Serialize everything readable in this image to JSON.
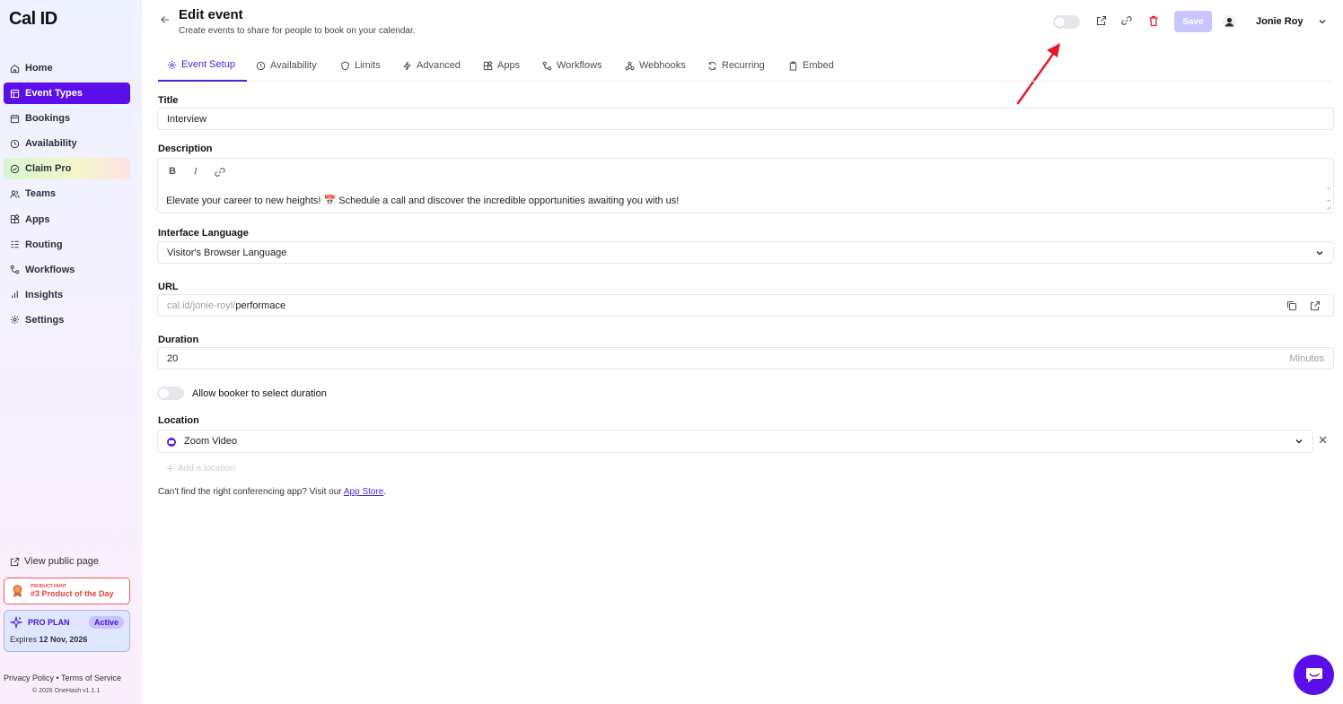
{
  "brand": {
    "logo_text": "Cal ID",
    "accent": "#5b0fe8"
  },
  "sidebar": {
    "items": [
      {
        "label": "Home",
        "icon": "home-icon"
      },
      {
        "label": "Event Types",
        "icon": "event-types-icon",
        "active": true
      },
      {
        "label": "Bookings",
        "icon": "calendar-icon"
      },
      {
        "label": "Availability",
        "icon": "clock-icon"
      },
      {
        "label": "Claim Pro",
        "icon": "badge-icon"
      },
      {
        "label": "Teams",
        "icon": "users-icon"
      },
      {
        "label": "Apps",
        "icon": "apps-icon"
      },
      {
        "label": "Routing",
        "icon": "routing-icon"
      },
      {
        "label": "Workflows",
        "icon": "workflow-icon"
      },
      {
        "label": "Insights",
        "icon": "chart-icon"
      },
      {
        "label": "Settings",
        "icon": "gear-icon"
      }
    ],
    "view_public_page": "View public page",
    "product_hunt": {
      "small": "PRODUCT HUNT",
      "big": "#3 Product of the Day"
    },
    "pro_plan": {
      "title": "PRO PLAN",
      "status": "Active",
      "expires_label": "Expires",
      "expires_date": "12 Nov, 2026"
    },
    "legal": {
      "privacy": "Privacy Policy",
      "separator": "•",
      "terms": "Terms of Service"
    },
    "copyright": "© 2026 OneHash v1.1.1"
  },
  "header": {
    "title": "Edit event",
    "subtitle": "Create events to share for people to book on your calendar.",
    "save_label": "Save",
    "user_name": "Jonie Roy"
  },
  "tabs": [
    {
      "label": "Event Setup",
      "icon": "gear-icon",
      "active": true
    },
    {
      "label": "Availability",
      "icon": "clock-icon"
    },
    {
      "label": "Limits",
      "icon": "shield-icon"
    },
    {
      "label": "Advanced",
      "icon": "bolt-icon"
    },
    {
      "label": "Apps",
      "icon": "apps-icon"
    },
    {
      "label": "Workflows",
      "icon": "workflow-icon"
    },
    {
      "label": "Webhooks",
      "icon": "webhook-icon"
    },
    {
      "label": "Recurring",
      "icon": "repeat-icon"
    },
    {
      "label": "Embed",
      "icon": "clipboard-icon"
    }
  ],
  "form": {
    "title_label": "Title",
    "title_value": "Interview",
    "description_label": "Description",
    "description_value": "Elevate your career to new heights! 📅 Schedule a call and discover the incredible opportunities awaiting you with us!",
    "format_buttons": {
      "bold": "B",
      "italic": "I"
    },
    "language_label": "Interface Language",
    "language_value": "Visitor's Browser Language",
    "url_label": "URL",
    "url_prefix": "cal.id/jonie-royl/",
    "url_slug": "performace",
    "duration_label": "Duration",
    "duration_value": "20",
    "duration_unit": "Minutes",
    "allow_duration_label": "Allow booker to select duration",
    "location_label": "Location",
    "location_value": "Zoom Video",
    "add_location": "Add a location",
    "cant_find_text": "Can't find the right conferencing app? Visit our",
    "app_store_link": "App Store",
    "trailing_period": "."
  },
  "colors": {
    "annotation_arrow": "#e8192c",
    "save_disabled": "#c9c5ff",
    "delete_icon": "#e8192c"
  }
}
